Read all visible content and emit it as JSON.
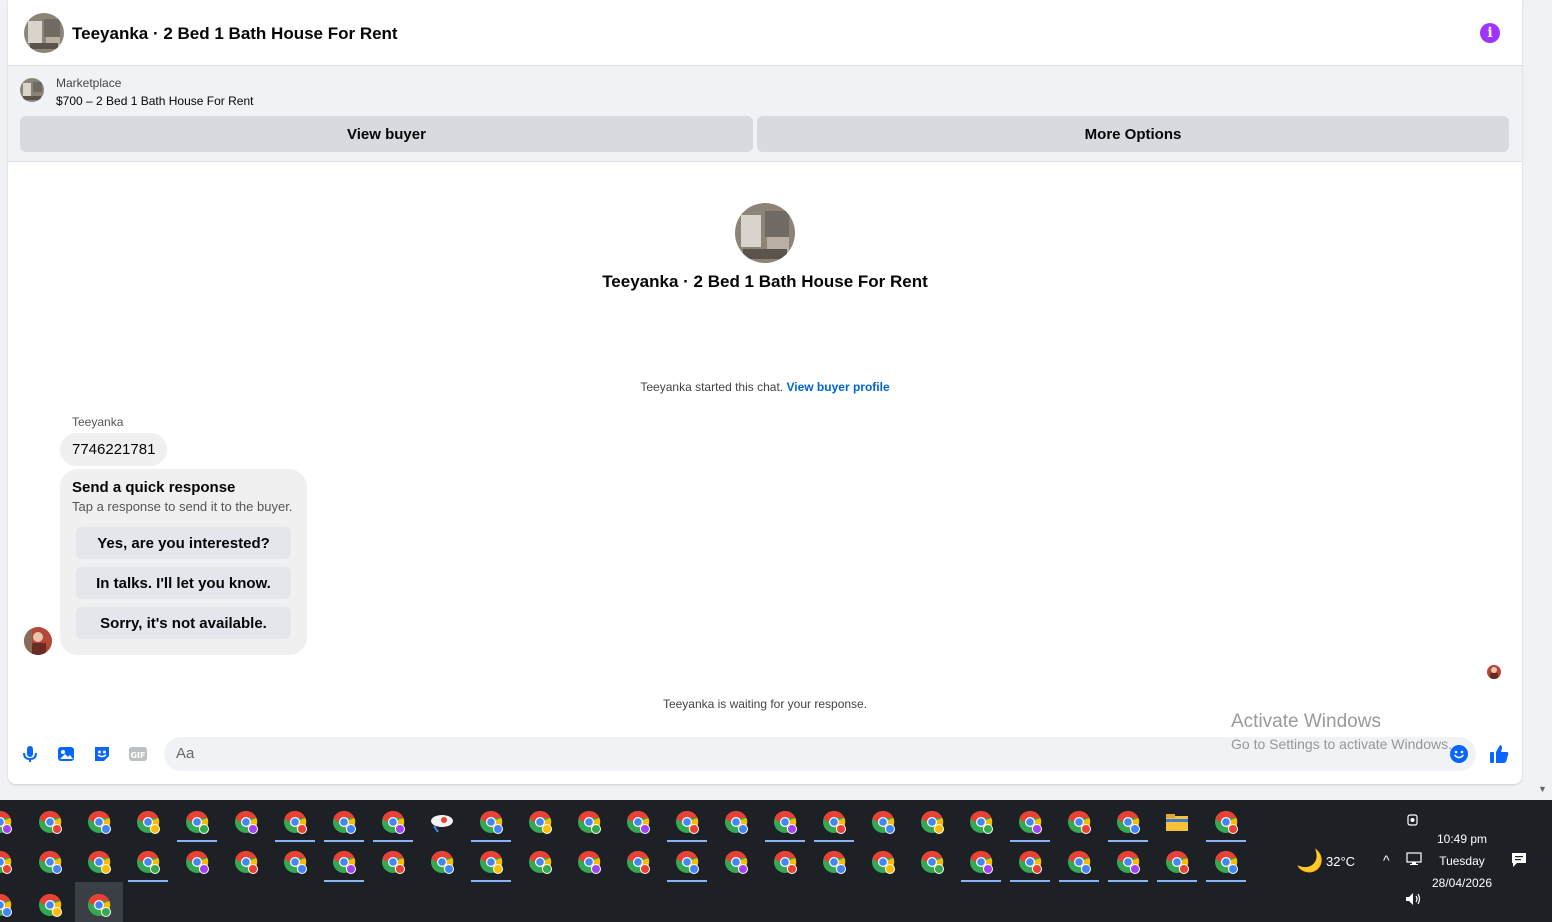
{
  "header": {
    "title": "Teeyanka · 2 Bed 1 Bath House For Rent",
    "info_icon": "i"
  },
  "listing": {
    "source": "Marketplace",
    "name": "$700 – 2 Bed 1 Bath House For Rent",
    "view_buyer_label": "View buyer",
    "more_options_label": "More Options"
  },
  "thread": {
    "title": "Teeyanka · 2 Bed 1 Bath House For Rent",
    "started_text": "Teeyanka started this chat.",
    "view_profile_link": "View buyer profile"
  },
  "message": {
    "sender": "Teeyanka",
    "phone": "7746221781",
    "quick_response": {
      "title": "Send a quick response",
      "subtitle": "Tap a response to send it to the buyer.",
      "options": [
        "Yes, are you interested?",
        "In talks. I'll let you know.",
        "Sorry, it's not available."
      ]
    }
  },
  "waiting_text": "Teeyanka is waiting for your response.",
  "composer": {
    "placeholder": "Aa"
  },
  "watermark": {
    "title": "Activate Windows",
    "subtitle": "Go to Settings to activate Windows."
  },
  "taskbar": {
    "weather": {
      "temp": "32°C",
      "icon": "moon-icon"
    },
    "time": "10:49 pm",
    "day": "Tuesday",
    "date": "28/04/2026"
  },
  "colors": {
    "accent_blue": "#0866ff",
    "info_purple": "#a033ff",
    "link_blue": "#0064d1",
    "taskbar_bg": "#1d2126"
  }
}
